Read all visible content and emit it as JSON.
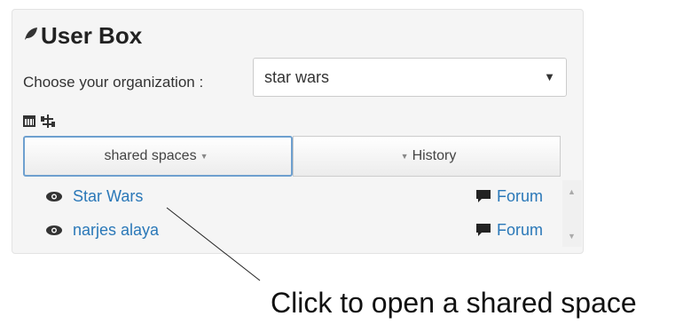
{
  "userbox": {
    "title": "User Box",
    "org_label": "Choose your organization :",
    "org_select_value": "star wars",
    "tabs": [
      {
        "label": "shared spaces"
      },
      {
        "label": "History"
      }
    ],
    "spaces": [
      {
        "name": "Star Wars",
        "forum_label": "Forum"
      },
      {
        "name": "narjes alaya",
        "forum_label": "Forum"
      }
    ]
  },
  "annotation": {
    "text": "Click to open a shared space"
  },
  "icons": {
    "title_icon": "leaf-icon",
    "calendar": "calendar-icon",
    "tree": "sitemap-icon",
    "eye": "eye-icon",
    "forum": "comment-icon"
  },
  "colors": {
    "link": "#2a78b8",
    "active_tab_border": "#6ea0cf",
    "panel_bg": "#f5f5f5"
  }
}
